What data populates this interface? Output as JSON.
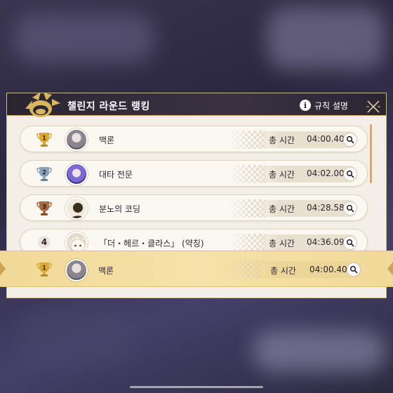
{
  "panel": {
    "title": "챌린지 라운드 랭킹",
    "rules_label": "규칙 설명",
    "close_icon": "close-x-icon",
    "header_emblem_icon": "sun-emblem-icon"
  },
  "rankings": [
    {
      "rank": "1",
      "badge_icon": "gold-trophy-icon",
      "badge_color": "#d8a93a",
      "name": "맥론",
      "avatar_icon": "grey-hair-character-avatar-icon",
      "time_label": "총 시간",
      "time": "04:00.40",
      "search_icon": "magnifier-icon"
    },
    {
      "rank": "2",
      "badge_icon": "silver-trophy-icon",
      "badge_color": "#8da2b8",
      "name": "대타 전문",
      "avatar_icon": "purple-hair-character-avatar-icon",
      "time_label": "총 시간",
      "time": "04:02.00",
      "search_icon": "magnifier-icon"
    },
    {
      "rank": "3",
      "badge_icon": "bronze-trophy-icon",
      "badge_color": "#a86a43",
      "name": "분노의 코딩",
      "avatar_icon": "silhouette-avatar-icon",
      "time_label": "총 시간",
      "time": "04:28.58",
      "search_icon": "magnifier-icon"
    },
    {
      "rank": "4",
      "badge_icon": "rank-number-icon",
      "badge_color": "#2b2532",
      "name": "「더・헤르・클라스」 (약칭)",
      "avatar_icon": "white-pet-avatar-icon",
      "time_label": "총 시간",
      "time": "04:36.09",
      "search_icon": "magnifier-icon"
    }
  ],
  "my_rank": {
    "rank": "1",
    "badge_icon": "gold-trophy-icon",
    "badge_color": "#d8a93a",
    "name": "맥론",
    "avatar_icon": "grey-hair-character-avatar-icon",
    "time_label": "총 시간",
    "time": "04:00.40",
    "search_icon": "magnifier-icon"
  },
  "colors": {
    "header_bg": "#2b2532",
    "accent_gold": "#c9a760",
    "highlight_row": "#f3dc9e",
    "scroll_accent": "#e0a75c"
  }
}
